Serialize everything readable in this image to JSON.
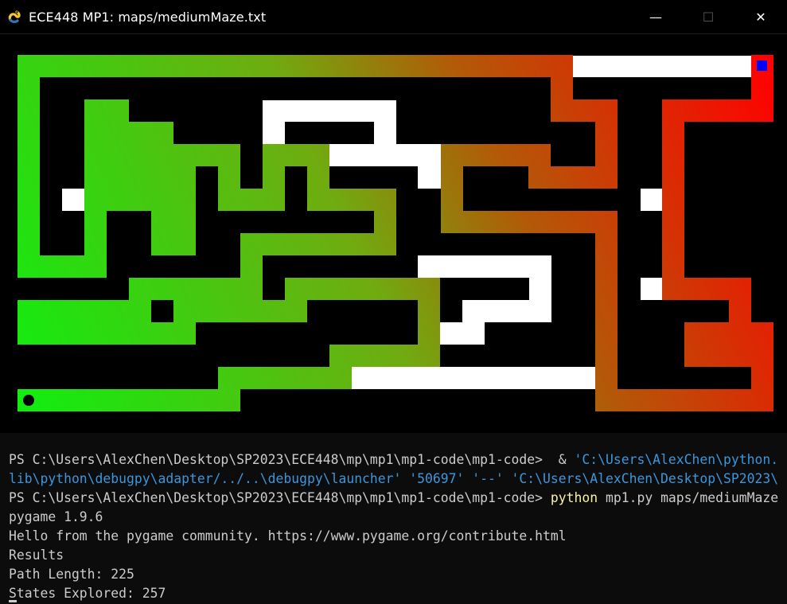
{
  "window": {
    "title": "ECE448 MP1: maps/mediumMaze.txt",
    "minimize_glyph": "—",
    "maximize_glyph": "☐",
    "close_glyph": "✕",
    "icon": "pygame-snake-icon"
  },
  "maze": {
    "colors": {
      "wall": "#000000",
      "explored": "#ffffff",
      "path_start": "#10ee10",
      "path_end": "#ff0000",
      "goal": "#0000ff",
      "agent": "#000000"
    }
  },
  "terminal": {
    "lines": [
      [
        {
          "text": "PS C:\\Users\\AlexChen\\Desktop\\SP2023\\ECE448\\mp\\mp1\\mp1-code\\mp1-code>  & ",
          "style": "plain"
        },
        {
          "text": "'C:\\Users\\AlexChen\\python.",
          "style": "cyan"
        }
      ],
      [
        {
          "text": "lib\\python\\debugpy\\adapter/../..\\debugpy\\launcher' '50697' '--' 'C:\\Users\\AlexChen\\Desktop\\SP2023\\",
          "style": "cyan"
        }
      ],
      [
        {
          "text": "PS C:\\Users\\AlexChen\\Desktop\\SP2023\\ECE448\\mp\\mp1\\mp1-code\\mp1-code> ",
          "style": "plain"
        },
        {
          "text": "python",
          "style": "yellow"
        },
        {
          "text": " mp1.py maps/mediumMaze",
          "style": "plain"
        }
      ],
      [
        {
          "text": "pygame 1.9.6",
          "style": "plain"
        }
      ],
      [
        {
          "text": "Hello from the pygame community. https://www.pygame.org/contribute.html",
          "style": "plain"
        }
      ],
      [
        {
          "text": "Results",
          "style": "plain"
        }
      ],
      [
        {
          "text": "Path Length: 225",
          "style": "plain"
        }
      ],
      [
        {
          "text": "States Explored: 257",
          "style": "plain"
        }
      ]
    ]
  }
}
